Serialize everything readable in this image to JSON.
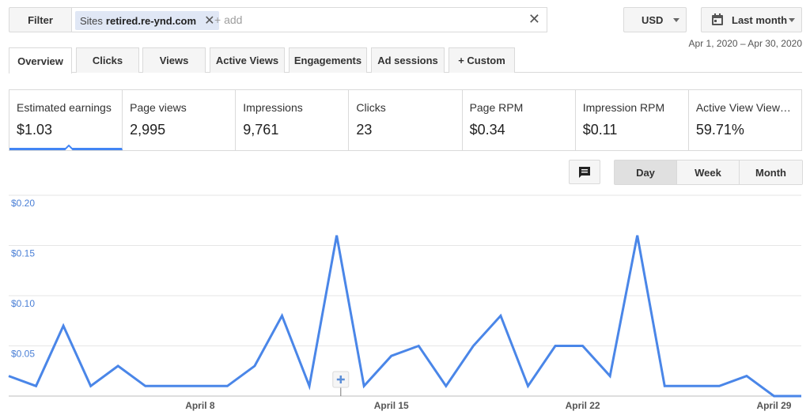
{
  "filter": {
    "label": "Filter",
    "chip_key": "Sites",
    "chip_value": "retired.re-ynd.com",
    "add_placeholder": "+ add"
  },
  "currency": "USD",
  "range_label": "Last month",
  "date_range": "Apr 1, 2020 – Apr 30, 2020",
  "tabs": [
    {
      "label": "Overview",
      "active": true
    },
    {
      "label": "Clicks"
    },
    {
      "label": "Views"
    },
    {
      "label": "Active Views"
    },
    {
      "label": "Engagements"
    },
    {
      "label": "Ad sessions"
    },
    {
      "label": "+  Custom"
    }
  ],
  "metrics": [
    {
      "label": "Estimated earnings",
      "value": "$1.03",
      "selected": true
    },
    {
      "label": "Page views",
      "value": "2,995"
    },
    {
      "label": "Impressions",
      "value": "9,761"
    },
    {
      "label": "Clicks",
      "value": "23"
    },
    {
      "label": "Page RPM",
      "value": "$0.34"
    },
    {
      "label": "Impression RPM",
      "value": "$0.11"
    },
    {
      "label": "Active View View…",
      "value": "59.71%"
    }
  ],
  "granularity": [
    "Day",
    "Week",
    "Month"
  ],
  "granularity_selected": "Day",
  "icons": {
    "annotation": "comment-icon",
    "calendar": "calendar-icon"
  },
  "colors": {
    "accent": "#4285f4",
    "line": "#4a86e8"
  },
  "chart_data": {
    "type": "line",
    "title": "",
    "xlabel": "",
    "ylabel": "",
    "ylim": [
      0,
      0.2
    ],
    "yticks": [
      "$0.20",
      "$0.15",
      "$0.10",
      "$0.05"
    ],
    "ytick_values": [
      0.2,
      0.15,
      0.1,
      0.05
    ],
    "xtick_labels": [
      "April 8",
      "April 15",
      "April 22",
      "April 29"
    ],
    "xtick_days": [
      8,
      15,
      22,
      29
    ],
    "x": [
      1,
      2,
      3,
      4,
      5,
      6,
      7,
      8,
      9,
      10,
      11,
      12,
      13,
      14,
      15,
      16,
      17,
      18,
      19,
      20,
      21,
      22,
      23,
      24,
      25,
      26,
      27,
      28,
      29,
      30
    ],
    "series": [
      {
        "values": [
          0.02,
          0.01,
          0.07,
          0.01,
          0.03,
          0.01,
          0.01,
          0.01,
          0.01,
          0.03,
          0.08,
          0.01,
          0.16,
          0.01,
          0.04,
          0.05,
          0.01,
          0.05,
          0.08,
          0.01,
          0.05,
          0.05,
          0.02,
          0.16,
          0.01,
          0.01,
          0.01,
          0.02,
          0.0,
          0.0
        ]
      }
    ]
  }
}
